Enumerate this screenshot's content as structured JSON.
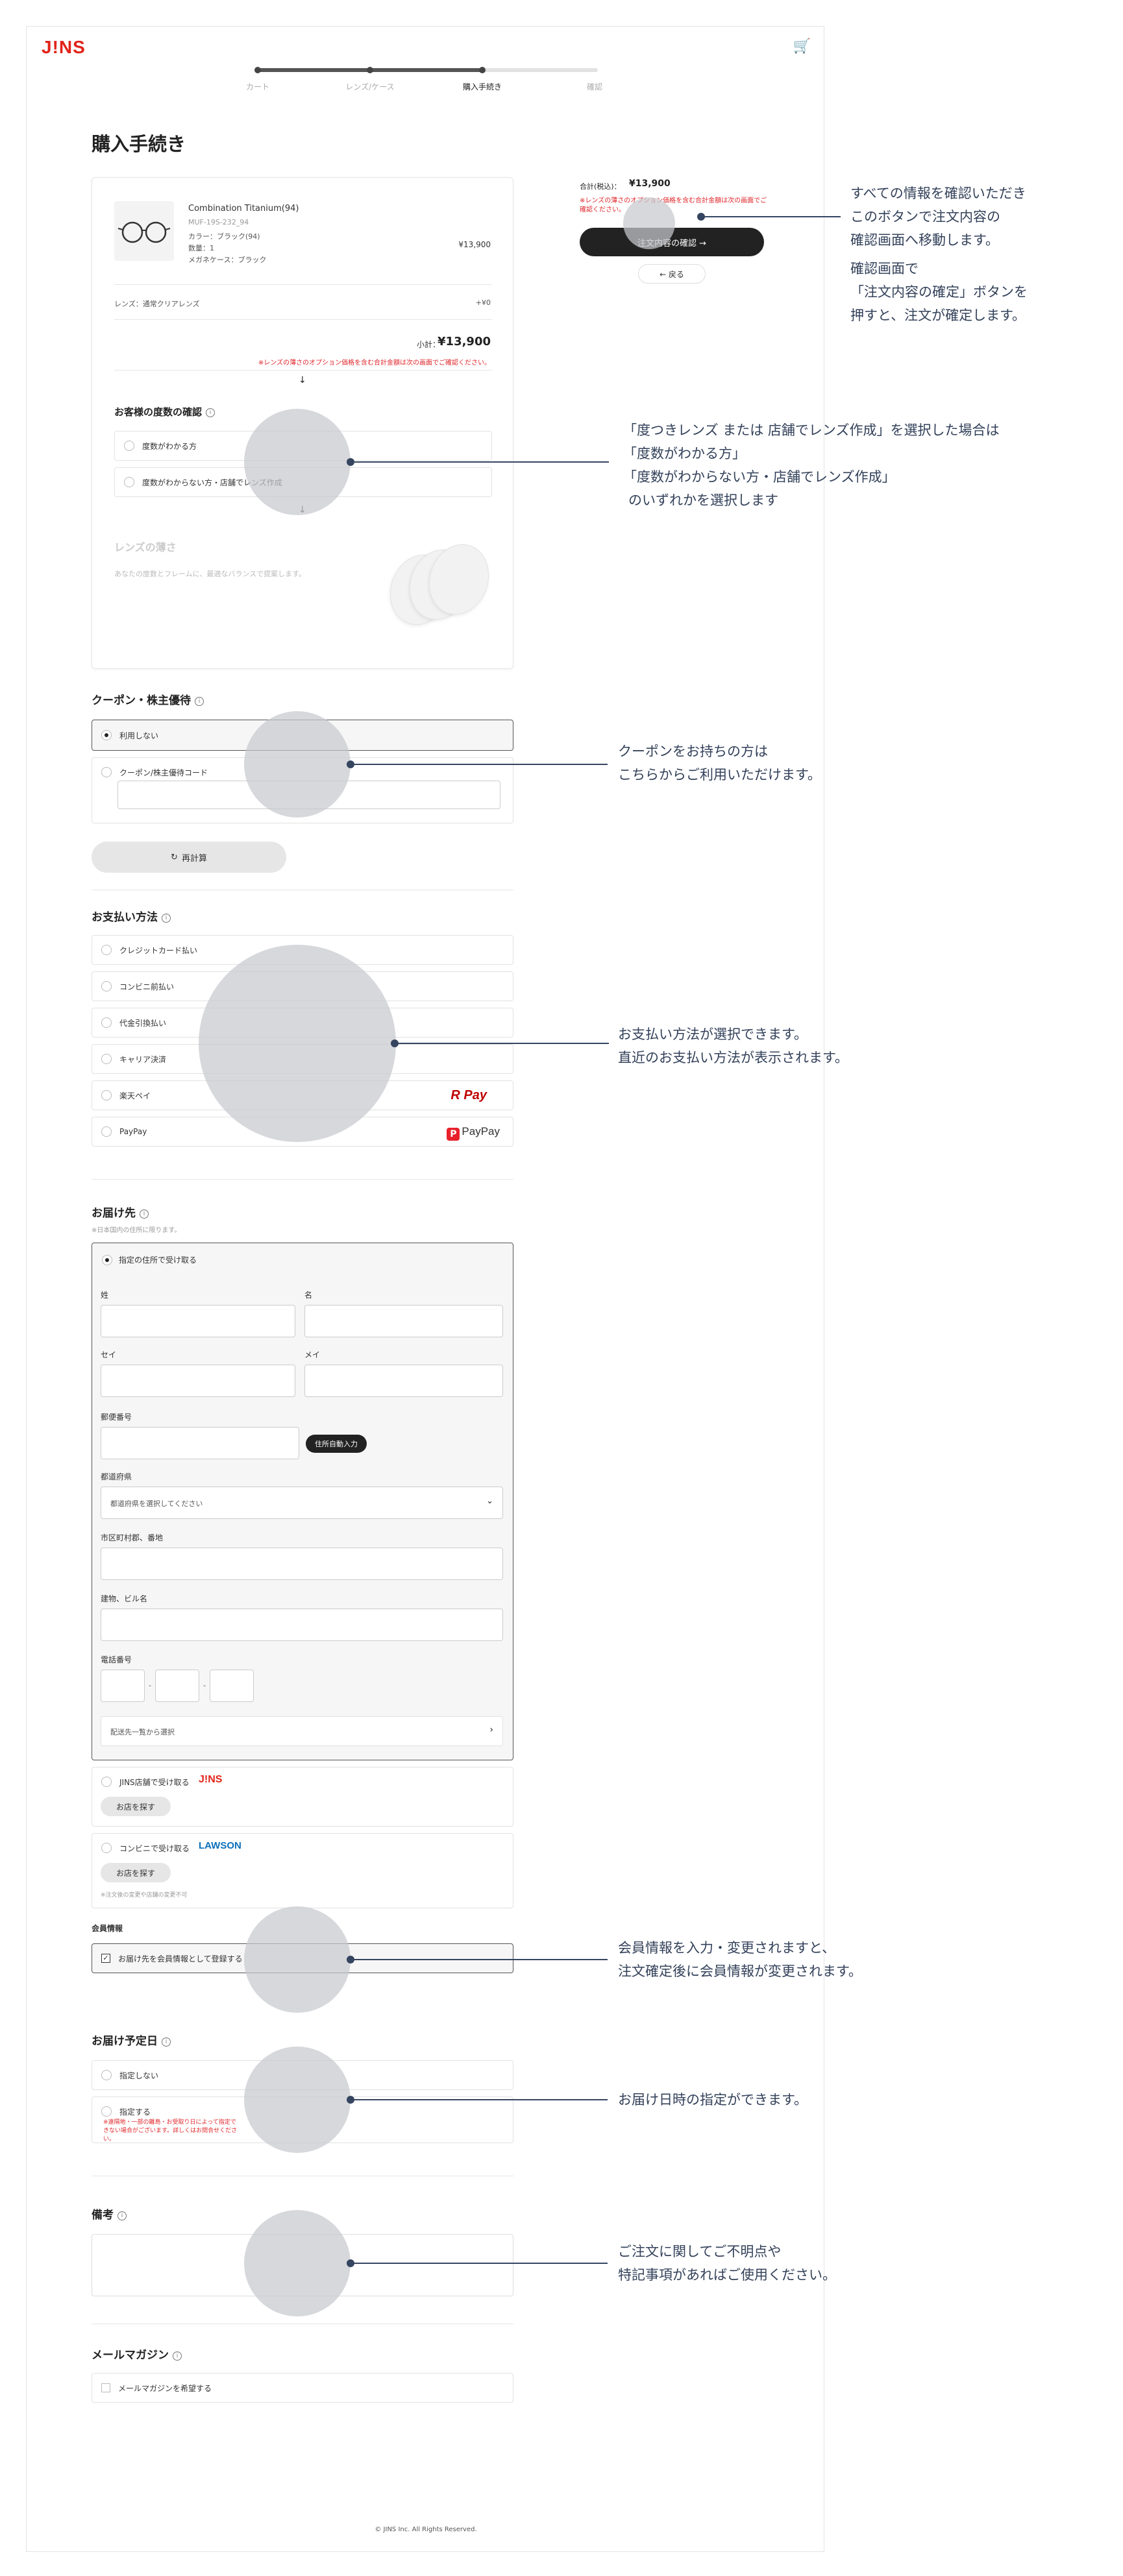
{
  "header": {
    "logo": "J!NS",
    "cart_icon": "cart-icon"
  },
  "steps": {
    "items": [
      "カート",
      "レンズ/ケース",
      "購入手続き",
      "確認"
    ],
    "current_index": 2
  },
  "page_title": "購入手続き",
  "product": {
    "name": "Combination Titanium(94)",
    "code": "MUF-19S-232_94",
    "color": "カラー：ブラック(94)",
    "qty": "数量：1",
    "case": "メガネケース：ブラック",
    "price": "¥13,900",
    "lens_label": "レンズ：通常クリアレンズ",
    "lens_price": "+¥0",
    "subtotal_label": "小計：",
    "subtotal_value": "¥13,900",
    "note": "※レンズの薄さのオプション価格を含む合計金額は次の画面でご確認ください。"
  },
  "prescription": {
    "title": "お客様の度数の確認",
    "options": [
      "度数がわかる方",
      "度数がわからない方・店舗でレンズ作成"
    ]
  },
  "lens_thickness": {
    "title": "レンズの薄さ",
    "desc": "あなたの度数とフレームに、最適なバランスで提案します。"
  },
  "summary": {
    "total_label": "合計(税込)：",
    "total_value": "¥13,900",
    "note": "※レンズの薄さのオプション価格を含む合計金額は次の画面でご確認ください。",
    "confirm_button": "注文内容の確認 →",
    "back_button": "← 戻る"
  },
  "coupon": {
    "title": "クーポン・株主優待",
    "options": [
      "利用しない",
      "クーポン/株主優待コード"
    ],
    "recalc_button": "再計算"
  },
  "payment": {
    "title": "お支払い方法",
    "options": [
      "クレジットカード払い",
      "コンビニ前払い",
      "代金引換払い",
      "キャリア決済",
      "楽天ペイ",
      "PayPay"
    ],
    "rakuten_logo": "R Pay",
    "paypay_logo": "PayPay"
  },
  "delivery": {
    "title": "お届け先",
    "sub": "※日本国内の住所に限ります。",
    "option_address": "指定の住所で受け取る",
    "last_name": "姓",
    "first_name": "名",
    "last_kana": "セイ",
    "first_kana": "メイ",
    "zip": "郵便番号",
    "auto_address_button": "住所自動入力",
    "prefecture": "都道府県",
    "prefecture_placeholder": "都道府県を選択してください",
    "city": "市区町村郡、番地",
    "building": "建物、ビル名",
    "phone": "電話番号",
    "address_list_button": "配送先一覧から選択",
    "option_store": "JINS店舗で受け取る",
    "store_logo": "J!NS",
    "find_store_button": "お店を探す",
    "option_conv": "コンビニで受け取る",
    "conv_logo": "LAWSON",
    "find_conv_button": "お店を探す",
    "conv_note": "※注文後の変更や店舗の変更不可"
  },
  "member": {
    "title": "会員情報",
    "checkbox_label": "お届け先を会員情報として登録する"
  },
  "delivery_date": {
    "title": "お届け予定日",
    "options": [
      "指定しない",
      "指定する"
    ],
    "note": "※遠隔地・一部の離島・お受取り日によって指定できない場合がございます。詳しくはお問合せください。"
  },
  "remarks": {
    "title": "備考"
  },
  "newsletter": {
    "title": "メールマガジン",
    "checkbox_label": "メールマガジンを希望する"
  },
  "footer": "© JINS Inc. All Rights Reserved.",
  "annotations": [
    {
      "lines": [
        "すべての情報を確認いただき",
        "このボタンで注文内容の",
        "確認画面へ移動します。",
        "確認画面で",
        "「注文内容の確定」ボタンを",
        "押すと、注文が確定します。"
      ]
    },
    {
      "lines": [
        "「度つきレンズ または 店舗でレンズ作成」を選択した場合は",
        "「度数がわかる方」",
        "「度数がわからない方・店舗でレンズ作成」",
        "のいずれかを選択します"
      ]
    },
    {
      "lines": [
        "クーポンをお持ちの方は",
        "こちらからご利用いただけます。"
      ]
    },
    {
      "lines": [
        "お支払い方法が選択できます。",
        "直近のお支払い方法が表示されます。"
      ]
    },
    {
      "lines": [
        "会員情報を入力・変更されますと、",
        "注文確定後に会員情報が変更されます。"
      ]
    },
    {
      "lines": [
        "お届け日時の指定ができます。"
      ]
    },
    {
      "lines": [
        "ご注文に関してご不明点や",
        "特記事項があればご使用ください。"
      ]
    }
  ]
}
